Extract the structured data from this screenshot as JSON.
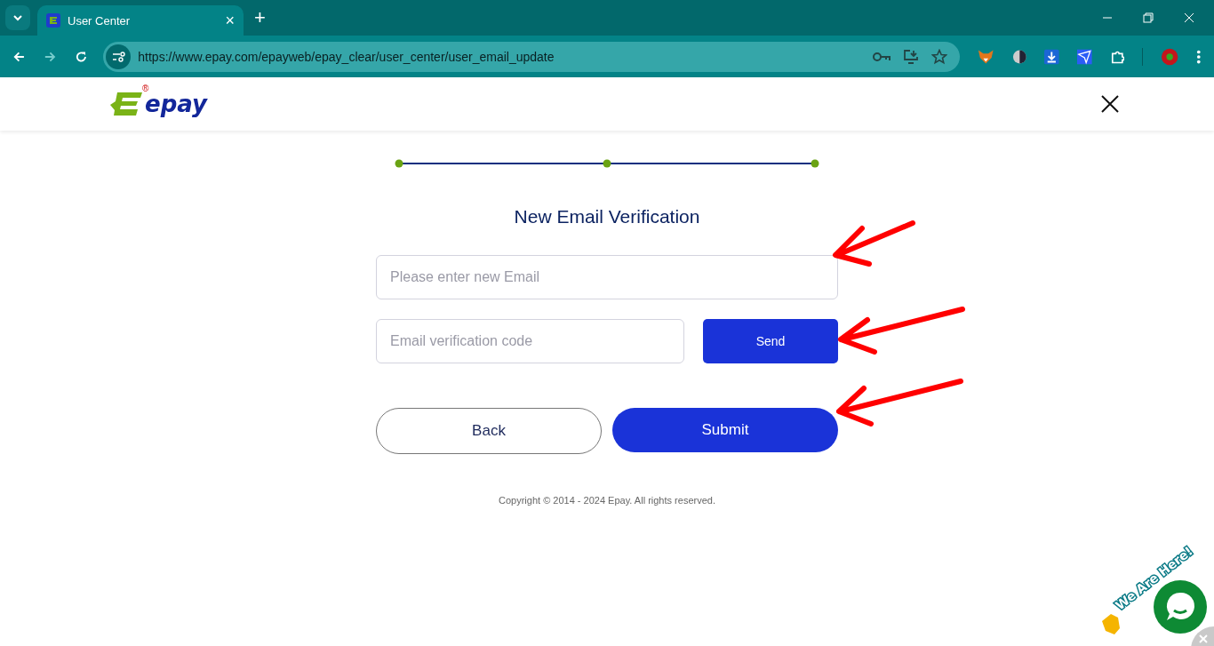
{
  "browser": {
    "tab": {
      "title": "User Center",
      "close": "×"
    },
    "new_tab": "+",
    "url": "https://www.epay.com/epayweb/epay_clear/user_center/user_email_update"
  },
  "header": {
    "logo_text": "epay",
    "logo_mark": "®"
  },
  "steps": [
    {
      "done": true
    },
    {
      "done": true
    },
    {
      "done": true
    }
  ],
  "form": {
    "title": "New Email Verification",
    "email": {
      "placeholder": "Please enter new Email"
    },
    "code": {
      "placeholder": "Email verification code"
    },
    "send": "Send",
    "back": "Back",
    "submit": "Submit"
  },
  "footer": "Copyright © 2014 - 2024 Epay. All rights reserved.",
  "chat": {
    "banner": "We Are Here!"
  }
}
